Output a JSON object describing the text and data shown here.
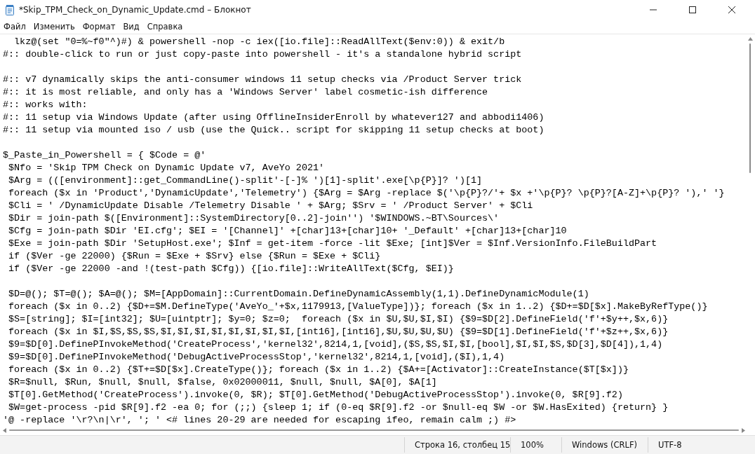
{
  "window": {
    "title": "*Skip_TPM_Check_on_Dynamic_Update.cmd – Блокнот"
  },
  "menu": [
    "Файл",
    "Изменить",
    "Формат",
    "Вид",
    "Справка"
  ],
  "editor": {
    "blocks": [
      [
        "  lkz@(set \"0=%~f0\"^)#) & powershell -nop -c iex([io.file]::ReadAllText($env:0)) & exit/b",
        "#:: double-click to run or just copy-paste into powershell - it's a standalone hybrid script"
      ],
      [
        "#:: v7 dynamically skips the anti-consumer windows 11 setup checks via /Product Server trick",
        "#:: it is most reliable, and only has a 'Windows Server' label cosmetic-ish difference",
        "#:: works with:",
        "#:: 11 setup via Windows Update (after using OfflineInsiderEnroll by whatever127 and abbodi1406)",
        "#:: 11 setup via mounted iso / usb (use the Quick.. script for skipping 11 setup checks at boot)"
      ],
      [
        "$_Paste_in_Powershell = { $Code = @'",
        " $Nfo = 'Skip TPM Check on Dynamic Update v7, AveYo 2021'",
        " $Arg = (([environment]::get_CommandLine()-split'-[-]% ')[1]-split'.exe[\\p{P}]? ')[1]",
        " foreach ($x in 'Product','DynamicUpdate','Telemetry') {$Arg = $Arg -replace $('\\p{P}?/'+ $x +'\\p{P}? \\p{P}?[A-Z]+\\p{P}? '),' '}",
        " $Cli = ' /DynamicUpdate Disable /Telemetry Disable ' + $Arg; $Srv = ' /Product Server' + $Cli",
        " $Dir = join-path $([Environment]::SystemDirectory[0..2]-join'') '$WINDOWS.~BT\\Sources\\'",
        " $Cfg = join-path $Dir 'EI.cfg'; $EI = '[Channel]' +[char]13+[char]10+ '_Default' +[char]13+[char]10",
        " $Exe = join-path $Dir 'SetupHost.exe'; $Inf = get-item -force -lit $Exe; [int]$Ver = $Inf.VersionInfo.FileBuildPart",
        " if ($Ver -ge 22000) {$Run = $Exe + $Srv} else {$Run = $Exe + $Cli}",
        " if ($Ver -ge 22000 -and !(test-path $Cfg)) {[io.file]::WriteAllText($Cfg, $EI)}"
      ],
      [
        " $D=@(); $T=@(); $A=@(); $M=[AppDomain]::CurrentDomain.DefineDynamicAssembly(1,1).DefineDynamicModule(1)",
        " foreach ($x in 0..2) {$D+=$M.DefineType('AveYo_'+$x,1179913,[ValueType])}; foreach ($x in 1..2) {$D+=$D[$x].MakeByRefType()}",
        " $S=[string]; $I=[int32]; $U=[uintptr]; $y=0; $z=0;  foreach ($x in $U,$U,$I,$I) {$9=$D[2].DefineField('f'+$y++,$x,6)}",
        " foreach ($x in $I,$S,$S,$S,$I,$I,$I,$I,$I,$I,$I,$I,[int16],[int16],$U,$U,$U,$U) {$9=$D[1].DefineField('f'+$z++,$x,6)}",
        " $9=$D[0].DefinePInvokeMethod('CreateProcess','kernel32',8214,1,[void],($S,$S,$I,$I,[bool],$I,$I,$S,$D[3],$D[4]),1,4)",
        " $9=$D[0].DefinePInvokeMethod('DebugActiveProcessStop','kernel32',8214,1,[void],($I),1,4)",
        " foreach ($x in 0..2) {$T+=$D[$x].CreateType()}; foreach ($x in 1..2) {$A+=[Activator]::CreateInstance($T[$x])}",
        " $R=$null, $Run, $null, $null, $false, 0x02000011, $null, $null, $A[0], $A[1]",
        " $T[0].GetMethod('CreateProcess').invoke(0, $R); $T[0].GetMethod('DebugActiveProcessStop').invoke(0, $R[9].f2)",
        " $W=get-process -pid $R[9].f2 -ea 0; for (;;) {sleep 1; if (0-eq $R[9].f2 -or $null-eq $W -or $W.HasExited) {return} }",
        "'@ -replace '\\r?\\n|\\r', '; ' <# lines 20-29 are needed for escaping ifeo, remain calm ;) #>"
      ]
    ]
  },
  "status_bar": [
    "Строка 16, столбец 15",
    "100%",
    "Windows (CRLF)",
    "UTF-8"
  ]
}
